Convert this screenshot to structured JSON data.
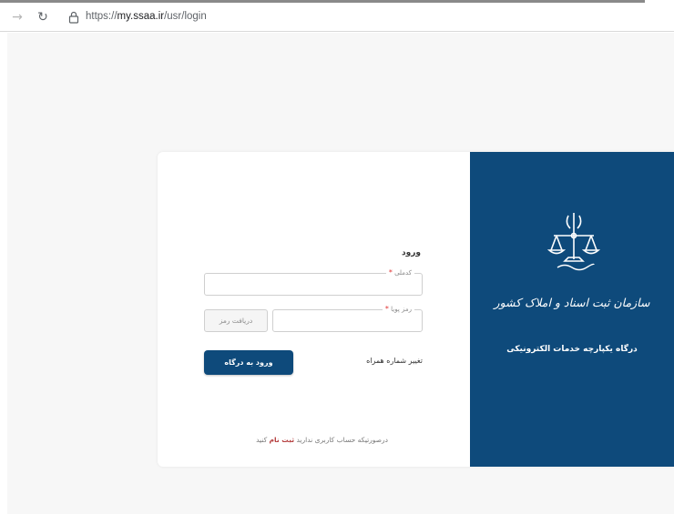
{
  "browser": {
    "forward_icon": "→",
    "reload_icon": "↻",
    "url_prefix": "https://",
    "url_host": "my.ssaa.ir",
    "url_path": "/usr/login"
  },
  "brand_panel": {
    "org_name": "سازمان ثبت اسناد و املاک کشور",
    "portal_name": "درگاه یکپارچه خدمات الکترونیکی",
    "background_color": "#0e4a7b"
  },
  "login_form": {
    "title": "ورود",
    "national_id": {
      "label": "کدملی",
      "required_mark": "*",
      "value": ""
    },
    "otp": {
      "label": "رمز پویا",
      "required_mark": "*",
      "value": ""
    },
    "get_code_button": "دریافت رمز",
    "change_phone_link": "تغییر شماره همراه",
    "login_button": "ورود به درگاه",
    "register_prefix": "درصورتیکه حساب کاربری ندارید",
    "register_link": "ثبت نام",
    "register_suffix": "کنید"
  }
}
